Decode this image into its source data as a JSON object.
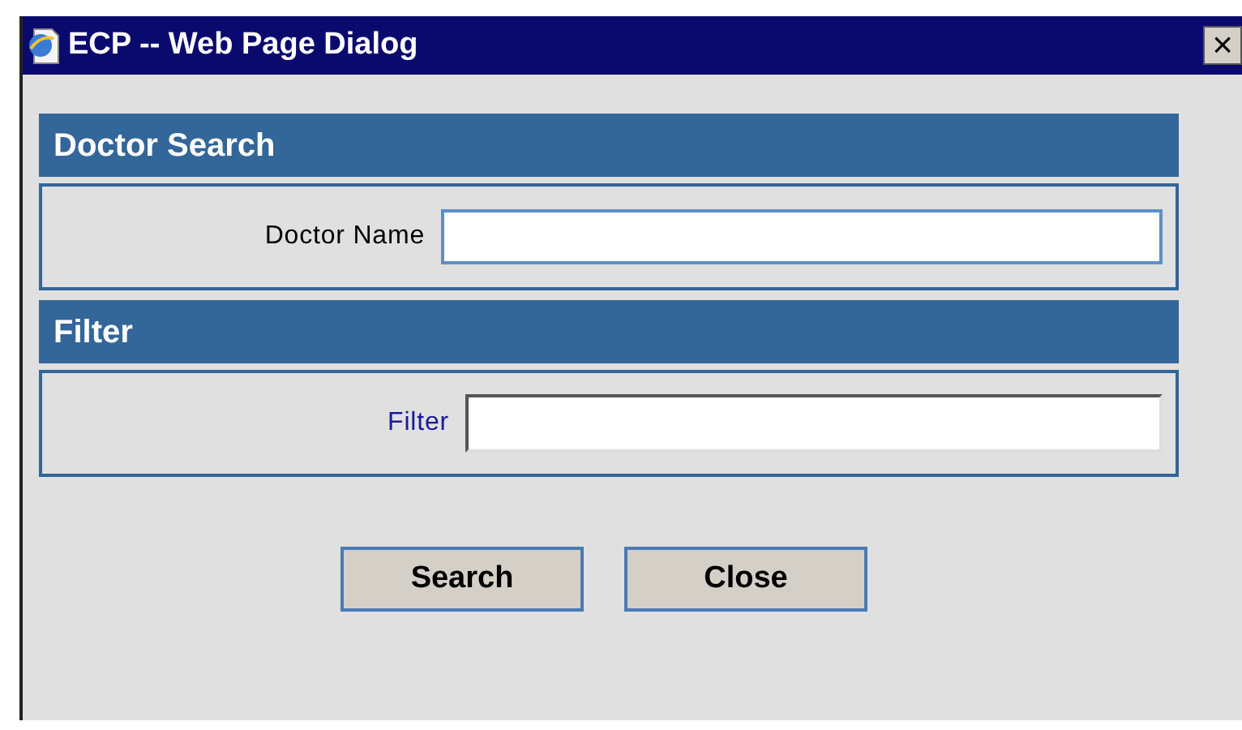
{
  "window": {
    "title": "ECP -- Web Page Dialog",
    "close": "×"
  },
  "sections": [
    {
      "title": "Doctor Search",
      "label": "Doctor Name",
      "kind": "plain"
    },
    {
      "title": "Filter",
      "label": "Filter",
      "kind": "link"
    }
  ],
  "buttons": [
    "Search",
    "Close"
  ]
}
